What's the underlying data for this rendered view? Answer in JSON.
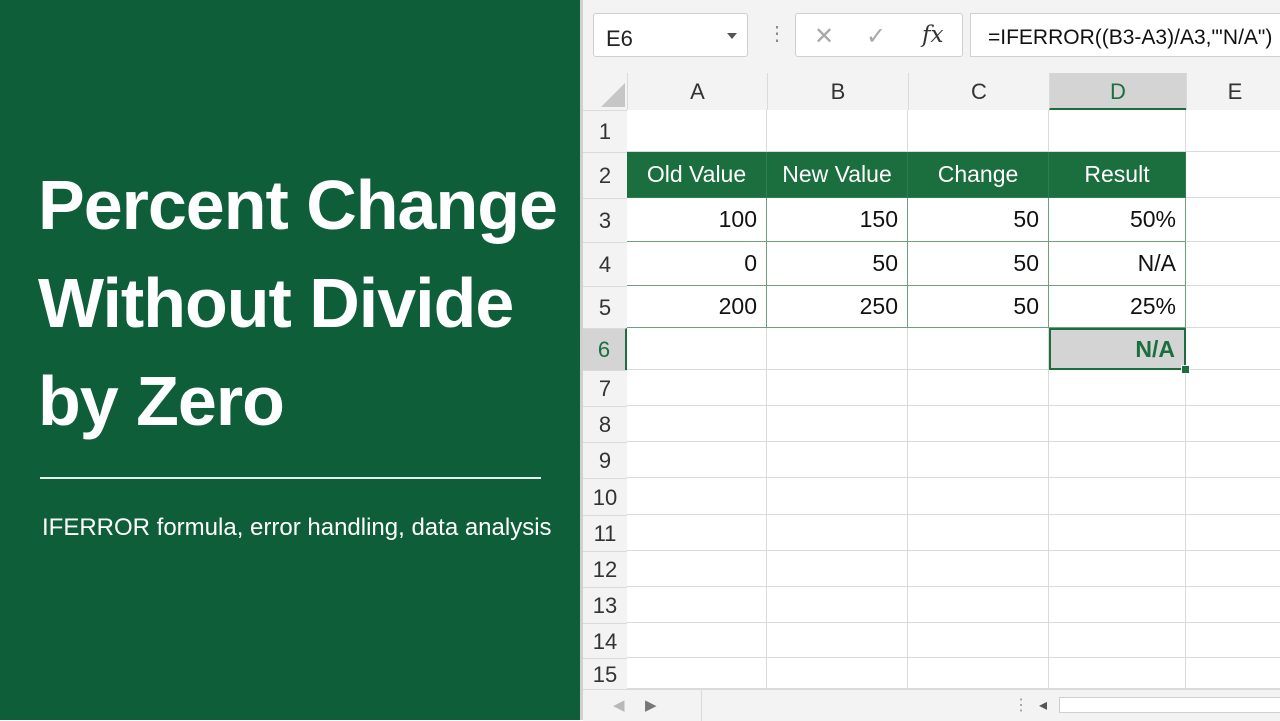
{
  "title": {
    "line1": "Percent Change",
    "line2": "Without Divide",
    "line3": "by Zero"
  },
  "subtitle": "IFERROR formula, error handling, data analysis",
  "formula_bar": {
    "name_box": "E6",
    "formula": "=IFERROR((B3-A3)/A3,\"'N/A\")"
  },
  "columns": [
    "A",
    "B",
    "C",
    "D",
    "E"
  ],
  "rows": [
    "1",
    "2",
    "3",
    "4",
    "5",
    "6",
    "7",
    "8",
    "9",
    "10",
    "11",
    "12",
    "13",
    "14",
    "15"
  ],
  "table": {
    "headers": [
      "Old Value",
      "New Value",
      "Change",
      "Result"
    ],
    "data": [
      [
        "100",
        "150",
        "50",
        "50%"
      ],
      [
        "0",
        "50",
        "50",
        "N/A"
      ],
      [
        "200",
        "250",
        "50",
        "25%"
      ]
    ],
    "selected_cell_value": "N/A"
  },
  "colors": {
    "panel_green": "#0f5e3a",
    "header_green": "#1b6e3e"
  },
  "icons": {
    "cancel": "close-icon",
    "enter": "check-icon",
    "function": "fx-icon"
  }
}
